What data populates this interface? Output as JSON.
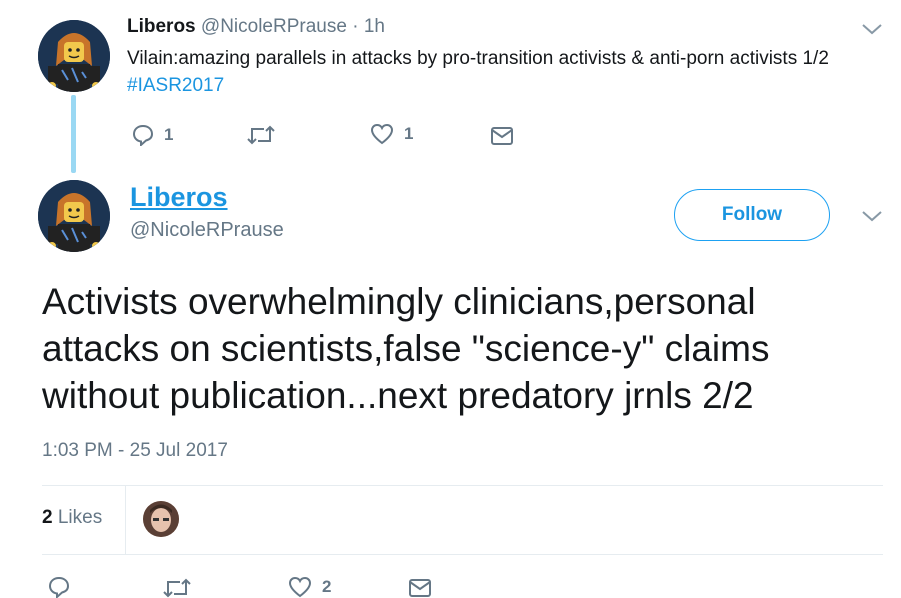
{
  "previous_tweet": {
    "author_name": "Liberos",
    "handle": "@NicoleRPrause",
    "separator": "·",
    "time": "1h",
    "text": "Vilain:amazing parallels in attacks by pro-transition activists & anti-porn activists 1/2",
    "hashtag": "#IASR2017",
    "reply_count": "1",
    "like_count": "1"
  },
  "main_tweet": {
    "author_name": "Liberos",
    "handle": "@NicoleRPrause",
    "follow_label": "Follow",
    "text": "Activists overwhelmingly clinicians,personal attacks on scientists,false \"science-y\" claims without publication...next predatory jrnls 2/2",
    "timestamp": "1:03 PM - 25 Jul 2017",
    "likes_count": "2",
    "likes_label": "Likes",
    "action_like_count": "2"
  },
  "icons": [
    "reply-icon",
    "retweet-icon",
    "heart-icon",
    "mail-icon",
    "chevron-down-icon"
  ],
  "colors": {
    "accent": "#1b95e0",
    "muted": "#657786",
    "thread_line": "#9ad8f3"
  }
}
